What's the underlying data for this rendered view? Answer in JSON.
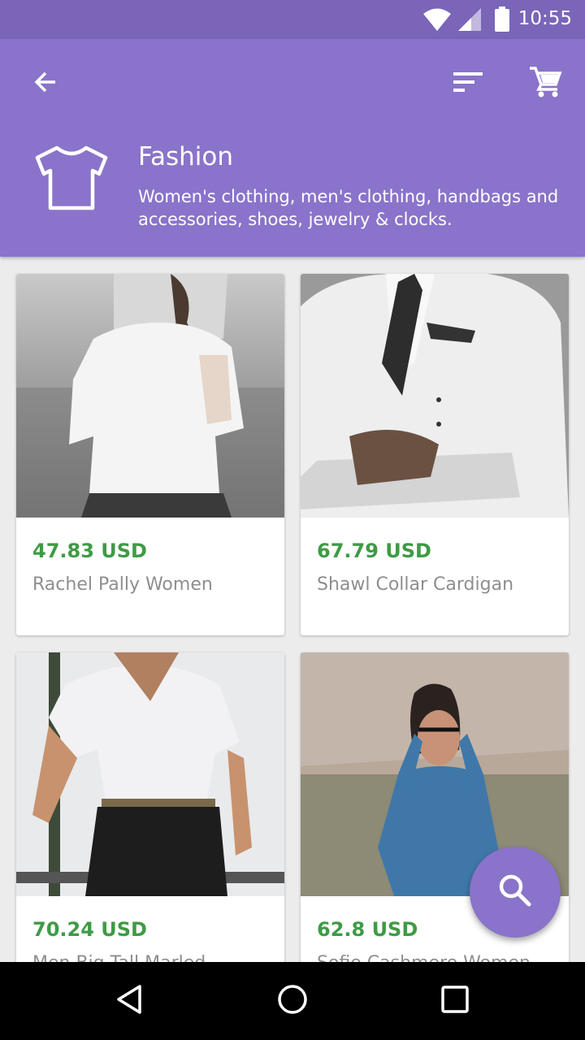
{
  "status_bar": {
    "time": "10:55",
    "icons": [
      "wifi-icon",
      "cell-signal-icon",
      "battery-icon"
    ]
  },
  "header": {
    "icons": [
      "back-arrow-icon",
      "sort-icon",
      "cart-icon",
      "tshirt-icon"
    ],
    "category_title": "Fashion",
    "category_description": "Women's clothing, men's clothing, handbags and accessories, shoes, jewelry & clocks.",
    "background_color": "#8a73ca"
  },
  "products": [
    {
      "price": "47.83 USD",
      "name": "Rachel Pally Women"
    },
    {
      "price": "67.79 USD",
      "name": "Shawl Collar Cardigan"
    },
    {
      "price": "70.24 USD",
      "name": "Men Big Tall Marled"
    },
    {
      "price": "62.8 USD",
      "name": "Sofie Cashmere Women"
    }
  ],
  "price_color": "#3e9b45",
  "fab": {
    "icon": "search-icon"
  },
  "nav_bar": {
    "icons": [
      "back-triangle-icon",
      "home-circle-icon",
      "recents-square-icon"
    ]
  }
}
